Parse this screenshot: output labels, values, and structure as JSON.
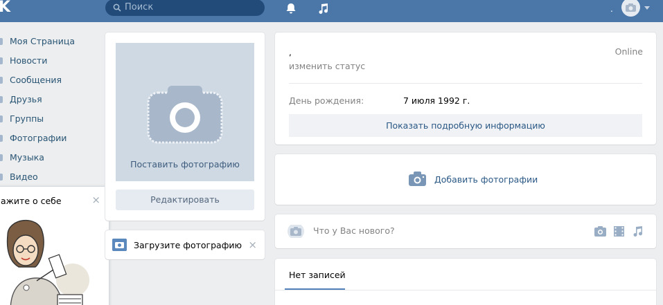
{
  "header": {
    "logo": "K",
    "search_placeholder": "Поиск",
    "user_name": "."
  },
  "sidebar": {
    "items": [
      {
        "label": "Моя Страница"
      },
      {
        "label": "Новости"
      },
      {
        "label": "Сообщения"
      },
      {
        "label": "Друзья"
      },
      {
        "label": "Группы"
      },
      {
        "label": "Фотографии"
      },
      {
        "label": "Музыка"
      },
      {
        "label": "Видео"
      }
    ]
  },
  "tooltip": {
    "title": "ажите о себе",
    "close": "×"
  },
  "photo_card": {
    "upload_label": "Поставить фотографию",
    "edit_button": "Редактировать"
  },
  "upload_notice": {
    "label": "Загрузите фотографию",
    "close": "×"
  },
  "profile": {
    "name": ",",
    "online": "Online",
    "change_status": "изменить статус",
    "birthday_label": "День рождения:",
    "birthday_value": "7 июля 1992 г.",
    "more_button": "Показать подробную информацию"
  },
  "add_photos": {
    "label": "Добавить фотографии"
  },
  "post_box": {
    "placeholder": "Что у Вас нового?"
  },
  "wall": {
    "tab": "Нет записей"
  },
  "colors": {
    "header": "#4a76a8",
    "link": "#2a5885",
    "accent": "#5181b8"
  }
}
